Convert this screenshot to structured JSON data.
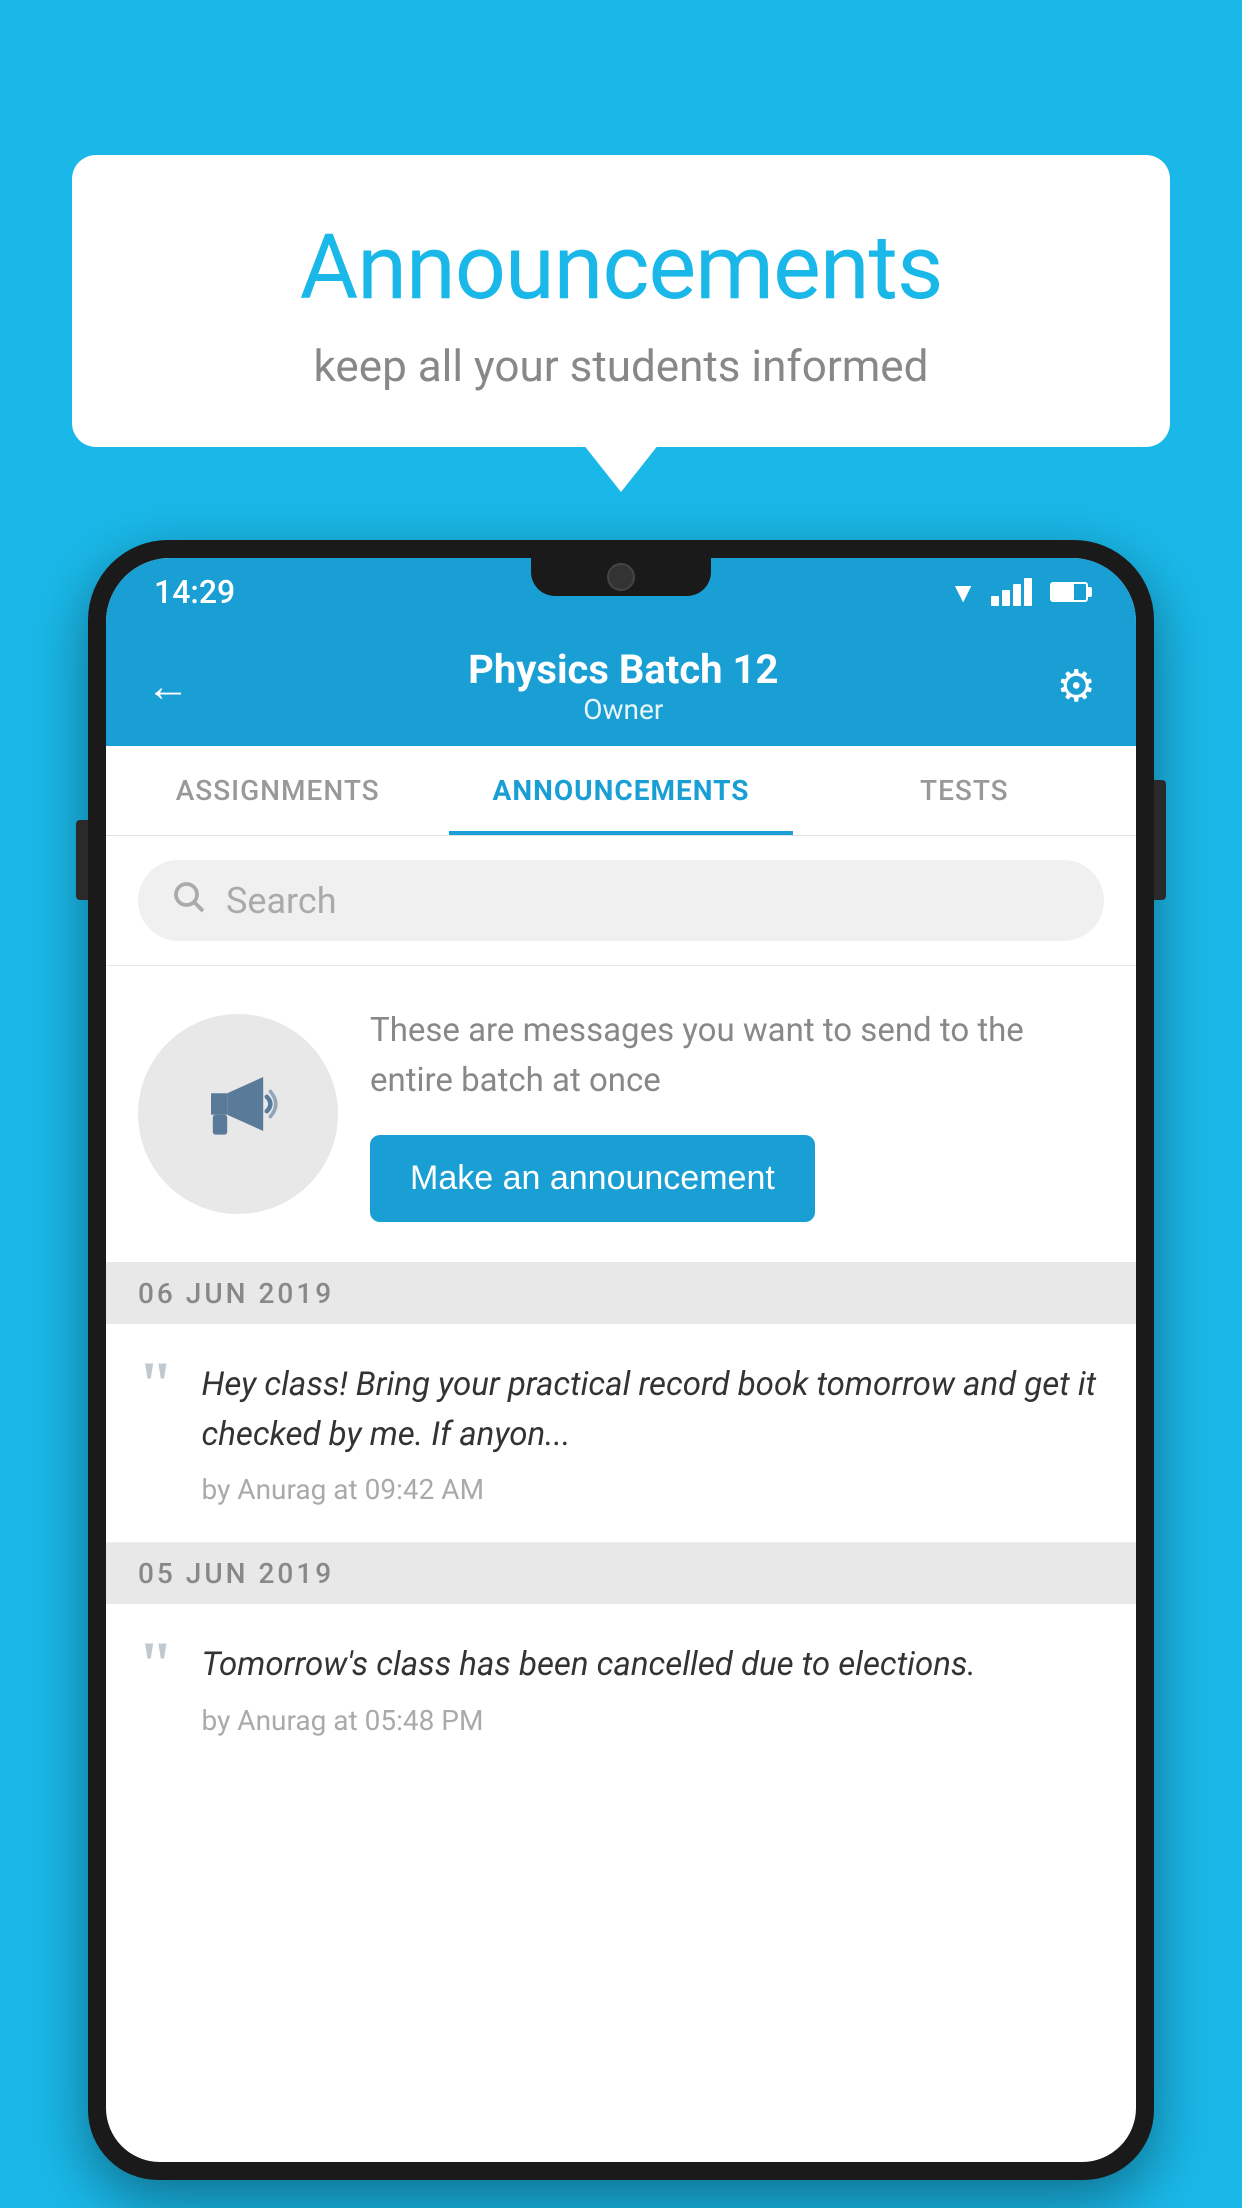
{
  "background_color": "#1ab8e8",
  "speech_bubble": {
    "title": "Announcements",
    "subtitle": "keep all your students informed"
  },
  "status_bar": {
    "time": "14:29",
    "wifi": true,
    "signal": true,
    "battery": true
  },
  "app_header": {
    "title": "Physics Batch 12",
    "subtitle": "Owner",
    "back_label": "←",
    "gear_label": "⚙"
  },
  "tabs": [
    {
      "label": "ASSIGNMENTS",
      "active": false
    },
    {
      "label": "ANNOUNCEMENTS",
      "active": true
    },
    {
      "label": "TESTS",
      "active": false
    }
  ],
  "search": {
    "placeholder": "Search"
  },
  "promo": {
    "description": "These are messages you want to send to the entire batch at once",
    "button_label": "Make an announcement"
  },
  "announcements": [
    {
      "date": "06  JUN  2019",
      "text": "Hey class! Bring your practical record book tomorrow and get it checked by me. If anyon...",
      "meta": "by Anurag at 09:42 AM"
    },
    {
      "date": "05  JUN  2019",
      "text": "Tomorrow's class has been cancelled due to elections.",
      "meta": "by Anurag at 05:48 PM"
    }
  ]
}
